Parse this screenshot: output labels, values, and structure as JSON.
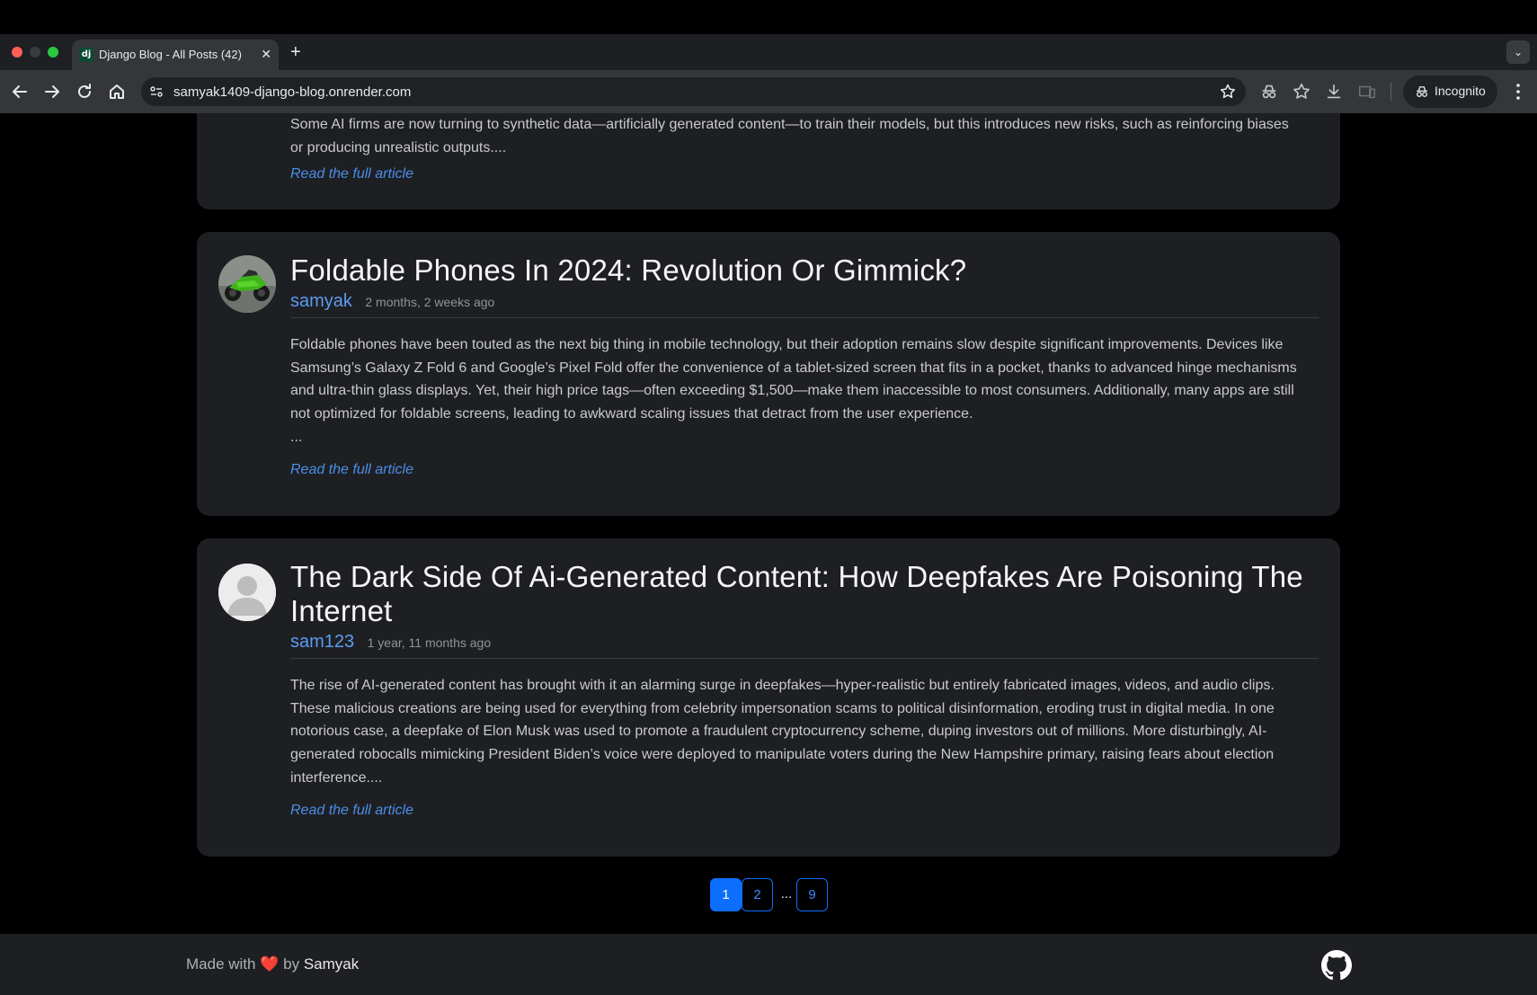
{
  "browser": {
    "tab_title": "Django Blog - All Posts (42)",
    "tab_favicon_text": "dj",
    "new_tab": "+",
    "url": "samyak1409-django-blog.onrender.com",
    "incognito_label": "Incognito"
  },
  "posts": [
    {
      "excerpt": "Some AI firms are now turning to synthetic data—artificially generated content—to train their models, but this introduces new risks, such as reinforcing biases or producing unrealistic outputs....",
      "read_more": "Read the full article"
    },
    {
      "title": "Foldable Phones In 2024: Revolution Or Gimmick?",
      "author": "samyak",
      "date": "2 months, 2 weeks ago",
      "excerpt": "Foldable phones have been touted as the next big thing in mobile technology, but their adoption remains slow despite significant improvements. Devices like Samsung’s Galaxy Z Fold 6 and Google’s Pixel Fold offer the convenience of a tablet-sized screen that fits in a pocket, thanks to advanced hinge mechanisms and ultra-thin glass displays. Yet, their high price tags—often exceeding $1,500—make them inaccessible to most consumers. Additionally, many apps are still not optimized for foldable screens, leading to awkward scaling issues that detract from the user experience.",
      "excerpt_tail": "...",
      "read_more": "Read the full article"
    },
    {
      "title": "The Dark Side Of Ai-Generated Content: How Deepfakes Are Poisoning The Internet",
      "author": "sam123",
      "date": "1 year, 11 months ago",
      "excerpt": "The rise of AI-generated content has brought with it an alarming surge in deepfakes—hyper-realistic but entirely fabricated images, videos, and audio clips. These malicious creations are being used for everything from celebrity impersonation scams to political disinformation, eroding trust in digital media. In one notorious case, a deepfake of Elon Musk was used to promote a fraudulent cryptocurrency scheme, duping investors out of millions. More disturbingly, AI-generated robocalls mimicking President Biden’s voice were deployed to manipulate voters during the New Hampshire primary, raising fears about election interference....",
      "read_more": "Read the full article"
    }
  ],
  "pagination": {
    "current": "1",
    "next": "2",
    "ellipsis": "...",
    "last": "9"
  },
  "footer": {
    "made_with": "Made with",
    "heart": "❤️",
    "by": "by",
    "author": "Samyak"
  },
  "colors": {
    "accent": "#0d6efd",
    "author_link": "#5b9cf0",
    "card_bg": "#1e1f23"
  }
}
